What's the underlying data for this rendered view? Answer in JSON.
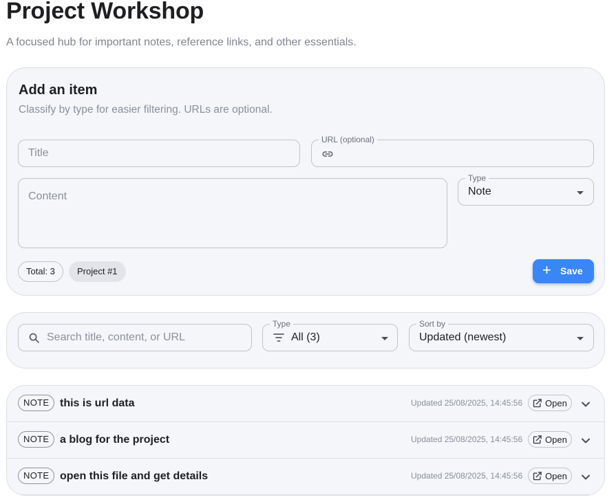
{
  "header": {
    "title": "Project Workshop",
    "subtitle": "A focused hub for important notes, reference links, and other essentials."
  },
  "add_item": {
    "title": "Add an item",
    "subtitle": "Classify by type for easier filtering. URLs are optional.",
    "title_field": {
      "placeholder": "Title",
      "value": ""
    },
    "url_field": {
      "label": "URL (optional)",
      "value": "",
      "icon": "link-icon"
    },
    "content_field": {
      "placeholder": "Content",
      "value": ""
    },
    "type_select": {
      "label": "Type",
      "value": "Note"
    },
    "total_chip": "Total: 3",
    "project_chip": "Project #1",
    "save_label": "Save"
  },
  "filters": {
    "search": {
      "placeholder": "Search title, content, or URL",
      "icon": "search-icon"
    },
    "type": {
      "label": "Type",
      "value": "All (3)",
      "icon": "filter-icon"
    },
    "sort": {
      "label": "Sort by",
      "value": "Updated (newest)"
    }
  },
  "items": [
    {
      "tag": "NOTE",
      "title": "this is url data",
      "updated": "Updated 25/08/2025, 14:45:56",
      "open_label": "Open"
    },
    {
      "tag": "NOTE",
      "title": "a blog for the project",
      "updated": "Updated 25/08/2025, 14:45:56",
      "open_label": "Open"
    },
    {
      "tag": "NOTE",
      "title": "open this file and get details",
      "updated": "Updated 25/08/2025, 14:45:56",
      "open_label": "Open"
    }
  ],
  "colors": {
    "accent": "#3b86f7",
    "card_background": "#f5f6f9",
    "border": "#bfc3ca"
  }
}
